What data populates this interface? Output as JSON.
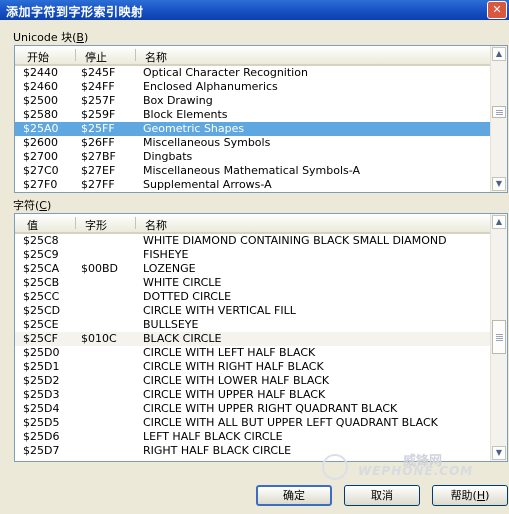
{
  "window": {
    "title": "添加字符到字形索引映射",
    "close_glyph": "✕"
  },
  "blocks": {
    "label": "Unicode 块(",
    "label_key": "B",
    "label_end": ")",
    "columns": [
      "开始",
      "停止",
      "名称"
    ],
    "rows": [
      {
        "start": "$2440",
        "end": "$245F",
        "name": "Optical Character Recognition"
      },
      {
        "start": "$2460",
        "end": "$24FF",
        "name": "Enclosed Alphanumerics"
      },
      {
        "start": "$2500",
        "end": "$257F",
        "name": "Box Drawing"
      },
      {
        "start": "$2580",
        "end": "$259F",
        "name": "Block Elements"
      },
      {
        "start": "$25A0",
        "end": "$25FF",
        "name": "Geometric Shapes",
        "selected": true
      },
      {
        "start": "$2600",
        "end": "$26FF",
        "name": "Miscellaneous Symbols"
      },
      {
        "start": "$2700",
        "end": "$27BF",
        "name": "Dingbats"
      },
      {
        "start": "$27C0",
        "end": "$27EF",
        "name": "Miscellaneous Mathematical Symbols-A"
      },
      {
        "start": "$27F0",
        "end": "$27FF",
        "name": "Supplemental Arrows-A"
      }
    ]
  },
  "chars": {
    "label": "字符(",
    "label_key": "C",
    "label_end": ")",
    "columns": [
      "值",
      "字形",
      "名称"
    ],
    "rows": [
      {
        "value": "$25C8",
        "glyph": "",
        "name": "WHITE DIAMOND CONTAINING BLACK SMALL DIAMOND"
      },
      {
        "value": "$25C9",
        "glyph": "",
        "name": "FISHEYE"
      },
      {
        "value": "$25CA",
        "glyph": "$00BD",
        "name": "LOZENGE"
      },
      {
        "value": "$25CB",
        "glyph": "",
        "name": "WHITE CIRCLE"
      },
      {
        "value": "$25CC",
        "glyph": "",
        "name": "DOTTED CIRCLE"
      },
      {
        "value": "$25CD",
        "glyph": "",
        "name": "CIRCLE WITH VERTICAL FILL"
      },
      {
        "value": "$25CE",
        "glyph": "",
        "name": "BULLSEYE"
      },
      {
        "value": "$25CF",
        "glyph": "$010C",
        "name": "BLACK CIRCLE",
        "current": true
      },
      {
        "value": "$25D0",
        "glyph": "",
        "name": "CIRCLE WITH LEFT HALF BLACK"
      },
      {
        "value": "$25D1",
        "glyph": "",
        "name": "CIRCLE WITH RIGHT HALF BLACK"
      },
      {
        "value": "$25D2",
        "glyph": "",
        "name": "CIRCLE WITH LOWER HALF BLACK"
      },
      {
        "value": "$25D3",
        "glyph": "",
        "name": "CIRCLE WITH UPPER HALF BLACK"
      },
      {
        "value": "$25D4",
        "glyph": "",
        "name": "CIRCLE WITH UPPER RIGHT QUADRANT BLACK"
      },
      {
        "value": "$25D5",
        "glyph": "",
        "name": "CIRCLE WITH ALL BUT UPPER LEFT QUADRANT BLACK"
      },
      {
        "value": "$25D6",
        "glyph": "",
        "name": "LEFT HALF BLACK CIRCLE"
      },
      {
        "value": "$25D7",
        "glyph": "",
        "name": "RIGHT HALF BLACK CIRCLE"
      }
    ]
  },
  "buttons": {
    "ok": "确定",
    "cancel": "取消",
    "help": "帮助(",
    "help_key": "H",
    "help_end": ")"
  },
  "watermark": {
    "line1": "威锋网",
    "line2": "WEPHONE.COM"
  },
  "colors": {
    "selection": "#5ea7e0",
    "titlebar": "#1b55c8"
  }
}
